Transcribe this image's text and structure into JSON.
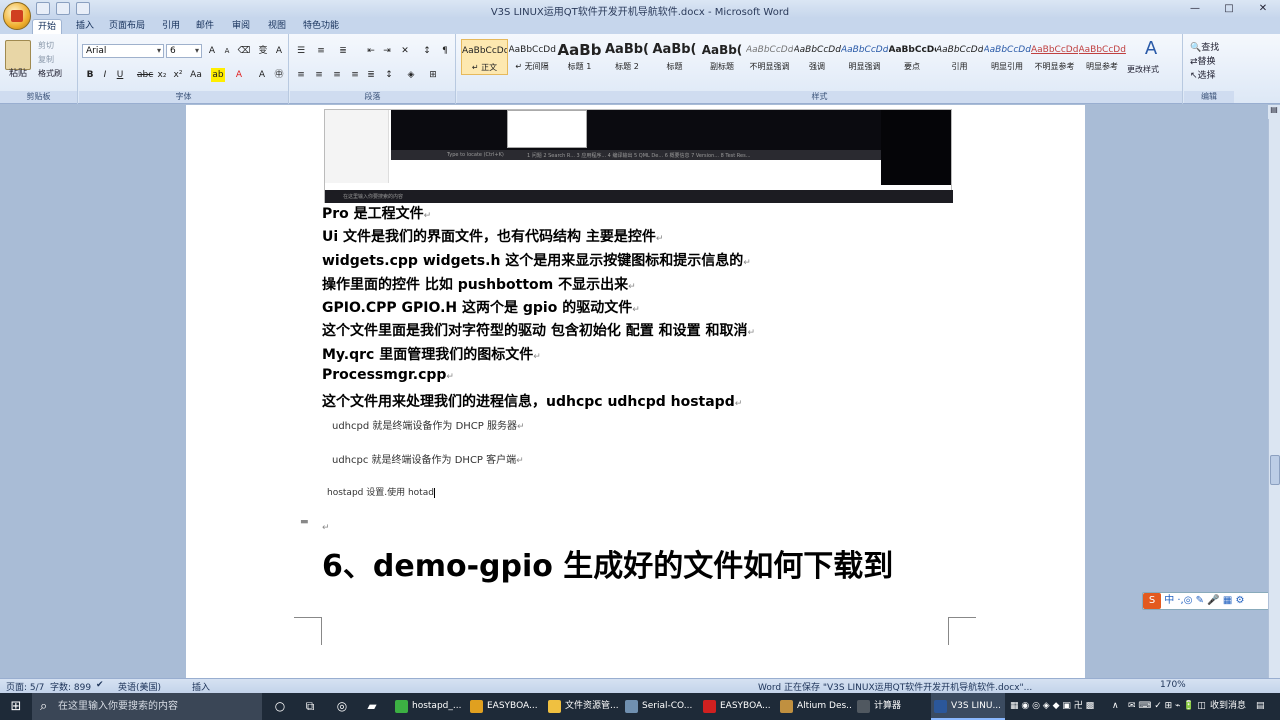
{
  "window": {
    "title": "V3S LINUX运用QT软件开发开机导航软件.docx - Microsoft Word",
    "controls": [
      "—",
      "□",
      "✕"
    ]
  },
  "ribbon": {
    "tabs": [
      "开始",
      "插入",
      "页面布局",
      "引用",
      "邮件",
      "审阅",
      "视图",
      "特色功能"
    ],
    "clipboard": {
      "paste": "粘贴",
      "cut": "剪切",
      "copy": "复制",
      "format_painter": "格式刷",
      "label": "剪贴板"
    },
    "font": {
      "name": "Arial",
      "size": "6",
      "label": "字体"
    },
    "paragraph": {
      "label": "段落"
    },
    "styles": {
      "label": "样式",
      "items": [
        {
          "sample": "AaBbCcDd",
          "name": "↵ 正文"
        },
        {
          "sample": "AaBbCcDd",
          "name": "↵ 无间隔"
        },
        {
          "sample": "AaBb",
          "name": "标题 1"
        },
        {
          "sample": "AaBb(",
          "name": "标题 2"
        },
        {
          "sample": "AaBb(",
          "name": "标题"
        },
        {
          "sample": "AaBb(",
          "name": "副标题"
        },
        {
          "sample": "AaBbCcDd",
          "name": "不明显强调"
        },
        {
          "sample": "AaBbCcDd",
          "name": "强调"
        },
        {
          "sample": "AaBbCcDd",
          "name": "明显强调"
        },
        {
          "sample": "AaBbCcDd",
          "name": "要点"
        },
        {
          "sample": "AaBbCcDd",
          "name": "引用"
        },
        {
          "sample": "AaBbCcDd",
          "name": "明显引用"
        },
        {
          "sample": "AaBbCcDd",
          "name": "不明显参考"
        },
        {
          "sample": "AaBbCcDd",
          "name": "明显参考"
        }
      ],
      "change_styles": "更改样式"
    },
    "editing": {
      "label": "编辑",
      "find": "查找",
      "replace": "替换",
      "select": "选择"
    }
  },
  "document": {
    "lines": [
      "Pro 是工程文件",
      "Ui 文件是我们的界面文件，也有代码结构 主要是控件",
      "widgets.cpp widgets.h 这个是用来显示按键图标和提示信息的",
      "操作里面的控件 比如 pushbottom 不显示出来",
      "GPIO.CPP GPIO.H  这两个是 gpio 的驱动文件",
      "这个文件里面是我们对字符型的驱动 包含初始化 配置 和设置 和取消",
      "My.qrc 里面管理我们的图标文件",
      "Processmgr.cpp",
      "这个文件用来处理我们的进程信息，udhcpc udhcpd hostapd"
    ],
    "small_lines": [
      "udhcpd 就是终端设备作为 DHCP 服务器",
      "udhcpc 就是终端设备作为 DHCP 客户端",
      "hostapd 设置.使用 hotad"
    ],
    "heading": "6、demo-gpio 生成好的文件如何下载到",
    "screenshot_tiny_text": [
      "Type to locate (Ctrl+K)",
      "1 问题  2 Search R...  3 应用程序...  4 编译输出  5 QML De...  6 概要信息  7 Version...  8 Test Res...",
      "在这里输入你要搜索的内容"
    ]
  },
  "statusbar": {
    "page": "页面: 5/7",
    "words": "字数: 899",
    "language": "英语(美国)",
    "mode": "插入",
    "saving": "Word 正在保存 \"V3S LINUX运用QT软件开发开机导航软件.docx\"...",
    "zoom": "170%"
  },
  "taskbar": {
    "search_placeholder": "在这里输入你要搜索的内容",
    "apps": [
      {
        "label": "hostapd_...",
        "color": "#3cb043"
      },
      {
        "label": "EASYBOA...",
        "color": "#e0a020"
      },
      {
        "label": "文件资源管...",
        "color": "#f0c040"
      },
      {
        "label": "Serial-CO...",
        "color": "#7090b0"
      },
      {
        "label": "EASYBOA...",
        "color": "#d02020"
      },
      {
        "label": "Altium Des...",
        "color": "#c09040"
      },
      {
        "label": "计算器",
        "color": "#505860"
      },
      {
        "label": "V3S LINU...",
        "color": "#2b579a"
      }
    ],
    "notification": "收到消息",
    "ime": "中"
  },
  "colors": {
    "ribbon_bg": "#dde8f6",
    "doc_bg": "#a9bcd6",
    "taskbar_bg": "#1e2a38",
    "squiggle": "#e04040"
  }
}
